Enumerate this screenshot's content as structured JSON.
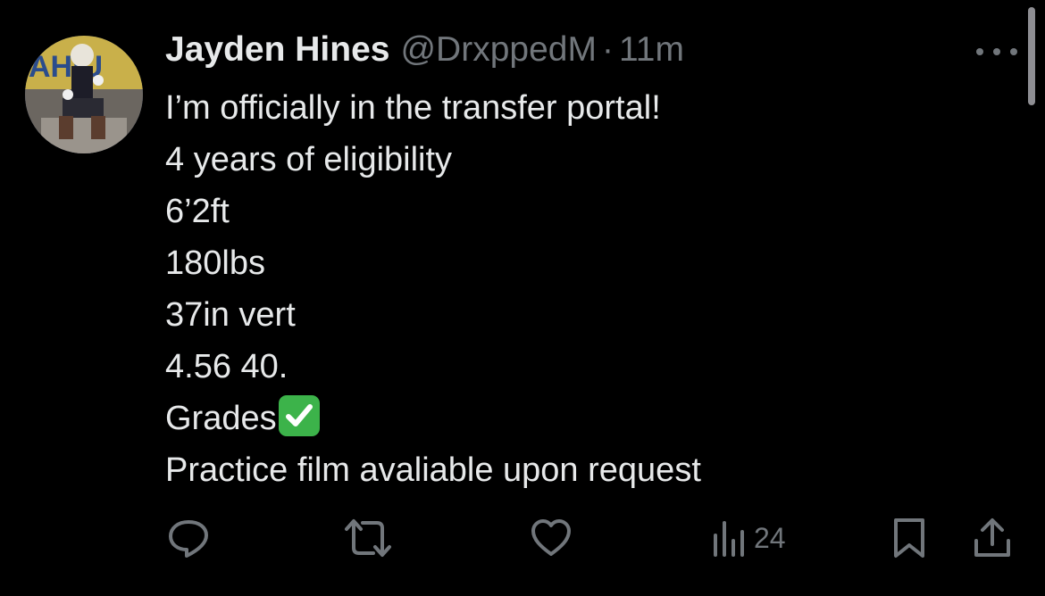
{
  "tweet": {
    "display_name": "Jayden Hines",
    "handle": "@DrxppedM",
    "separator": "·",
    "time": "11m",
    "avatar_text": "AHIU",
    "lines": [
      "I’m officially in the transfer portal!",
      "4 years of eligibility",
      "6’2ft",
      "180lbs",
      "37in vert",
      "4.56 40.",
      "Grades",
      "Practice film avaliable upon request"
    ]
  },
  "actions": {
    "views_count": "24",
    "icons": [
      "reply-icon",
      "retweet-icon",
      "like-icon",
      "views-icon",
      "bookmark-icon",
      "share-icon"
    ]
  },
  "colors": {
    "background": "#000000",
    "text": "#e7e9ea",
    "muted": "#71767b",
    "check_green": "#3cb34a"
  }
}
